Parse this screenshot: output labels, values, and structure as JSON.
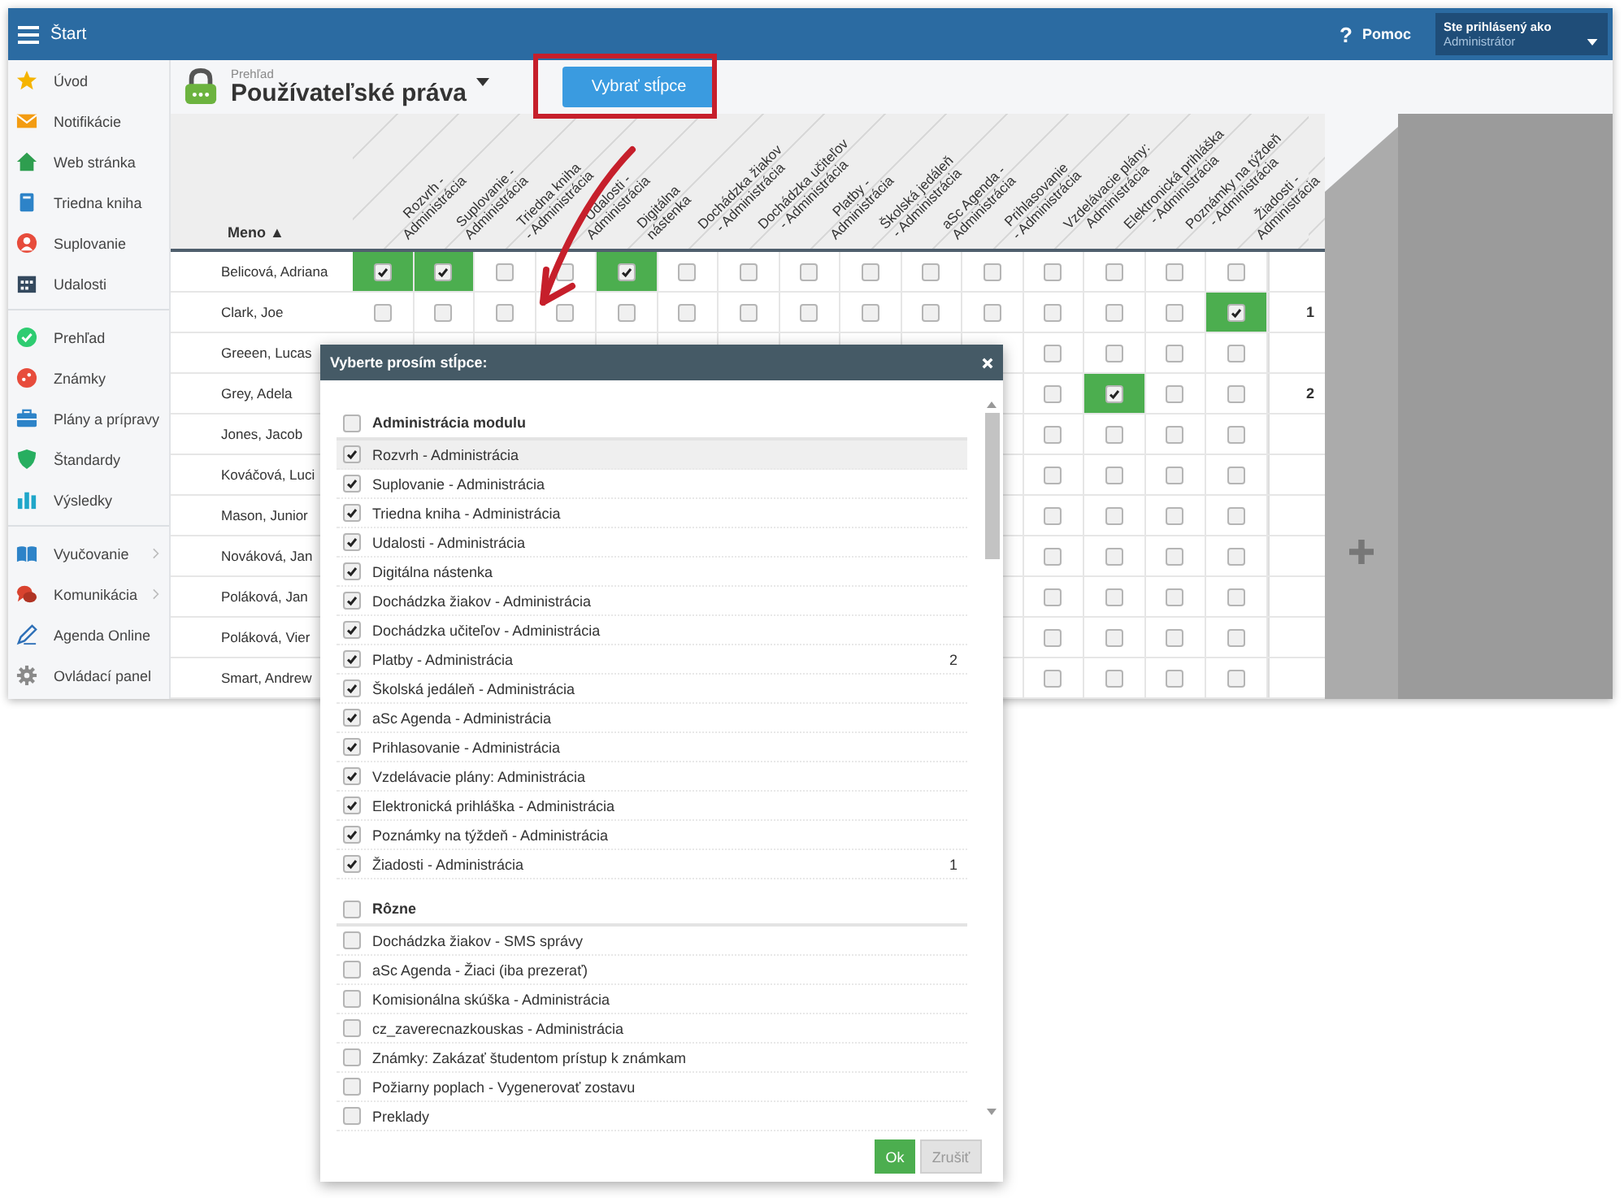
{
  "topbar": {
    "title": "Štart",
    "help_symbol": "?",
    "help": "Pomoc",
    "user": {
      "caption": "Ste prihlásený ako",
      "role": "Administrátor"
    }
  },
  "sidebar": {
    "sections": [
      {
        "items": [
          {
            "label": "Úvod",
            "submenu": false
          },
          {
            "label": "Notifikácie",
            "submenu": false
          },
          {
            "label": "Web stránka",
            "submenu": false
          },
          {
            "label": "Triedna kniha",
            "submenu": false
          },
          {
            "label": "Suplovanie",
            "submenu": false
          },
          {
            "label": "Udalosti",
            "submenu": false
          }
        ]
      },
      {
        "items": [
          {
            "label": "Prehľad",
            "submenu": false
          },
          {
            "label": "Známky",
            "submenu": false
          },
          {
            "label": "Plány a prípravy",
            "submenu": false
          },
          {
            "label": "Štandardy",
            "submenu": false
          },
          {
            "label": "Výsledky",
            "submenu": false
          }
        ]
      },
      {
        "items": [
          {
            "label": "Vyučovanie",
            "submenu": true
          },
          {
            "label": "Komunikácia",
            "submenu": true
          },
          {
            "label": "Agenda Online",
            "submenu": false
          },
          {
            "label": "Ovládací panel",
            "submenu": false
          }
        ]
      }
    ]
  },
  "page": {
    "breadcrumb": "Prehľad",
    "title": "Používateľské práva",
    "button": "Vybrať stĺpce"
  },
  "table": {
    "name_header": "Meno ▲",
    "columns": [
      "Rozvrh -\nAdministrácia",
      "Suplovanie -\nAdministrácia",
      "Triedna kniha\n- Administrácia",
      "Udalosti -\nAdministrácia",
      "Digitálna\nnástenka",
      "Dochádzka žiakov\n- Administrácia",
      "Dochádzka učiteľov\n- Administrácia",
      "Platby -\nAdministrácia",
      "Školská jedáleň\n- Administrácia",
      "aSc Agenda -\nAdministrácia",
      "Prihlasovanie\n- Administrácia",
      "Vzdelávacie plány:\nAdministrácia",
      "Elektronická prihláška\n- Administrácia",
      "Poznámky na týždeň\n- Administrácia",
      "Žiadosti -\nAdministrácia"
    ],
    "rows": [
      {
        "name": "Belicová, Adriana",
        "cells": [
          {
            "checked": true
          },
          {
            "checked": true
          },
          {
            "checked": false
          },
          {
            "checked": false
          },
          {
            "checked": true
          },
          {
            "checked": false
          },
          {
            "checked": false
          },
          {
            "checked": false
          },
          {
            "checked": false
          },
          {
            "checked": false
          },
          {
            "checked": false
          },
          {
            "checked": false
          },
          {
            "checked": false
          },
          {
            "checked": false
          },
          {
            "checked": false
          }
        ]
      },
      {
        "name": "Clark, Joe",
        "cells": [
          {
            "checked": false
          },
          {
            "checked": false
          },
          {
            "checked": false
          },
          {
            "checked": false
          },
          {
            "checked": false
          },
          {
            "checked": false
          },
          {
            "checked": false
          },
          {
            "checked": false
          },
          {
            "checked": false
          },
          {
            "checked": false
          },
          {
            "checked": false
          },
          {
            "checked": false
          },
          {
            "checked": false
          },
          {
            "checked": false
          },
          {
            "checked": true
          }
        ],
        "count": "1"
      },
      {
        "name": "Greeen, Lucas",
        "cells": [
          {
            "checked": false
          },
          {
            "checked": false
          },
          {
            "checked": false
          },
          {
            "checked": false
          }
        ]
      },
      {
        "name": "Grey, Adela",
        "cells": [
          {
            "checked": false
          },
          {
            "checked": true
          },
          {
            "checked": false
          },
          {
            "checked": false
          }
        ],
        "count": "2"
      },
      {
        "name": "Jones, Jacob",
        "cells": [
          {
            "checked": false
          },
          {
            "checked": false
          },
          {
            "checked": false
          },
          {
            "checked": false
          }
        ]
      },
      {
        "name": "Kováčová, Luci",
        "cells": [
          {
            "checked": false
          },
          {
            "checked": false
          },
          {
            "checked": false
          },
          {
            "checked": false
          }
        ]
      },
      {
        "name": "Mason, Junior",
        "cells": [
          {
            "checked": false
          },
          {
            "checked": false
          },
          {
            "checked": false
          },
          {
            "checked": false
          }
        ]
      },
      {
        "name": "Nováková, Jan",
        "cells": [
          {
            "checked": false
          },
          {
            "checked": false
          },
          {
            "checked": false
          },
          {
            "checked": false
          }
        ]
      },
      {
        "name": "Poláková, Jan",
        "cells": [
          {
            "checked": false
          },
          {
            "checked": false
          },
          {
            "checked": false
          },
          {
            "checked": false
          }
        ]
      },
      {
        "name": "Poláková, Vier",
        "cells": [
          {
            "checked": false
          },
          {
            "checked": false
          },
          {
            "checked": false
          },
          {
            "checked": false
          }
        ]
      },
      {
        "name": "Smart, Andrew",
        "cells": [
          {
            "checked": false
          },
          {
            "checked": false
          },
          {
            "checked": false
          },
          {
            "checked": false
          }
        ]
      }
    ]
  },
  "dialog": {
    "title": "Vyberte prosím stĺpce:",
    "groups": [
      {
        "label": "Administrácia modulu",
        "checked": false,
        "items": [
          {
            "label": "Rozvrh - Administrácia",
            "checked": true,
            "selected": true
          },
          {
            "label": "Suplovanie - Administrácia",
            "checked": true,
            "selected": false
          },
          {
            "label": "Triedna kniha - Administrácia",
            "checked": true,
            "selected": false
          },
          {
            "label": "Udalosti - Administrácia",
            "checked": true,
            "selected": false
          },
          {
            "label": "Digitálna nástenka",
            "checked": true,
            "selected": false
          },
          {
            "label": "Dochádzka žiakov - Administrácia",
            "checked": true,
            "selected": false
          },
          {
            "label": "Dochádzka učiteľov - Administrácia",
            "checked": true,
            "selected": false
          },
          {
            "label": "Platby - Administrácia",
            "checked": true,
            "selected": false,
            "count": "2"
          },
          {
            "label": "Školská jedáleň - Administrácia",
            "checked": true,
            "selected": false
          },
          {
            "label": "aSc Agenda - Administrácia",
            "checked": true,
            "selected": false
          },
          {
            "label": "Prihlasovanie - Administrácia",
            "checked": true,
            "selected": false
          },
          {
            "label": "Vzdelávacie plány: Administrácia",
            "checked": true,
            "selected": false
          },
          {
            "label": "Elektronická prihláška - Administrácia",
            "checked": true,
            "selected": false
          },
          {
            "label": "Poznámky na týždeň - Administrácia",
            "checked": true,
            "selected": false
          },
          {
            "label": "Žiadosti - Administrácia",
            "checked": true,
            "selected": false,
            "count": "1"
          }
        ]
      },
      {
        "label": "Rôzne",
        "checked": false,
        "items": [
          {
            "label": "Dochádzka žiakov - SMS správy",
            "checked": false,
            "selected": false
          },
          {
            "label": "aSc Agenda - Žiaci (iba prezerať)",
            "checked": false,
            "selected": false
          },
          {
            "label": "Komisionálna skúška - Administrácia",
            "checked": false,
            "selected": false
          },
          {
            "label": "cz_zaverecnazkouskas - Administrácia",
            "checked": false,
            "selected": false
          },
          {
            "label": "Známky: Zakázať študentom prístup k známkam",
            "checked": false,
            "selected": false
          },
          {
            "label": "Požiarny poplach - Vygenerovať zostavu",
            "checked": false,
            "selected": false
          },
          {
            "label": "Preklady",
            "checked": false,
            "selected": false
          }
        ]
      }
    ],
    "buttons": [
      {
        "label": "Ok",
        "kind": "primary"
      },
      {
        "label": "Zrušiť",
        "kind": "secondary"
      }
    ]
  }
}
